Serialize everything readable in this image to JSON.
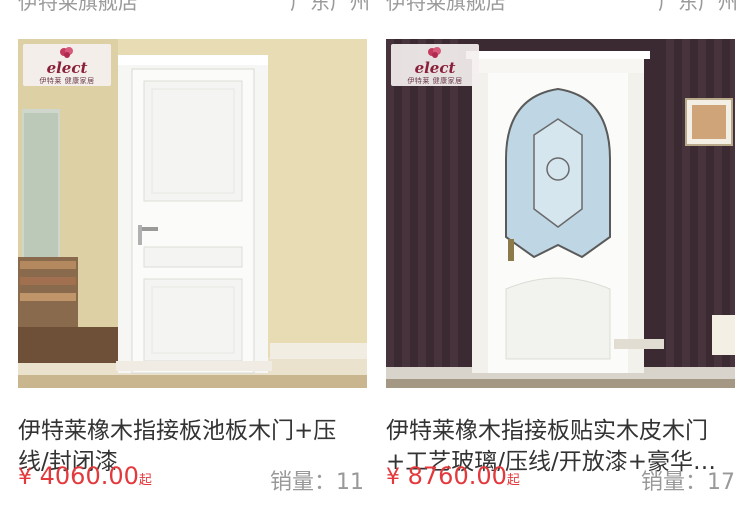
{
  "top_row": {
    "left_shop": "伊特莱旗舰店",
    "left_location": "广东广州",
    "right_shop": "伊特莱旗舰店",
    "right_location": "广东广州"
  },
  "products": [
    {
      "brand_logo": "elect",
      "brand_logo_sub": "伊特莱 健康家居",
      "title": "伊特莱橡木指接板池板木门+压线/封闭漆",
      "price_currency": "¥",
      "price": "4060.00",
      "price_suffix": "起",
      "sales": "销量：11"
    },
    {
      "brand_logo": "elect",
      "brand_logo_sub": "伊特莱 健康家居",
      "title": "伊特莱橡木指接板贴实木皮木门+工艺玻璃/压线/开放漆+豪华门套",
      "price_currency": "¥",
      "price": "8760.00",
      "price_suffix": "起",
      "sales": "销量：17"
    }
  ],
  "colors": {
    "price": "#e4393c",
    "title": "#333333",
    "muted": "#999999"
  }
}
